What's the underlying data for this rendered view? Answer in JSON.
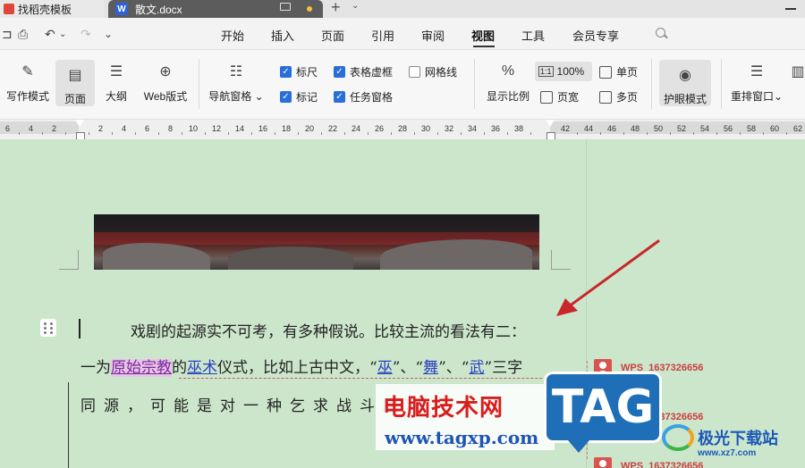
{
  "tabs": {
    "templates_label": "找稻壳模板",
    "doc_label": "散文.docx",
    "add_label": "+",
    "more_label": "⌄"
  },
  "menu": {
    "items": [
      "开始",
      "插入",
      "页面",
      "引用",
      "审阅",
      "视图",
      "工具",
      "会员专享"
    ],
    "active": "视图"
  },
  "ribbon": {
    "buttons": {
      "writing_mode": "写作模式",
      "page": "页面",
      "outline": "大纲",
      "web_layout": "Web版式",
      "nav_pane": "导航窗格",
      "zoom_ratio": "显示比例",
      "eye_protection": "护眼模式",
      "rearrange": "重排窗口"
    },
    "checkboxes": {
      "ruler": {
        "label": "标尺",
        "checked": true
      },
      "table_gridlines": {
        "label": "表格虚框",
        "checked": true
      },
      "gridlines": {
        "label": "网格线",
        "checked": false
      },
      "marks": {
        "label": "标记",
        "checked": true
      },
      "task_pane": {
        "label": "任务窗格",
        "checked": true
      }
    },
    "zoom_100": "100%",
    "zoom_100_icon_text": "1:1",
    "single_page": "单页",
    "page_width": "页宽",
    "multi_page": "多页"
  },
  "ruler": {
    "numbers": [
      "6",
      "4",
      "2",
      "2",
      "4",
      "6",
      "8",
      "10",
      "12",
      "14",
      "16",
      "18",
      "20",
      "22",
      "24",
      "26",
      "28",
      "30",
      "32",
      "34",
      "36",
      "38",
      "42",
      "44",
      "46",
      "48",
      "50",
      "52",
      "54",
      "56",
      "58",
      "60",
      "62"
    ]
  },
  "document": {
    "line1": "戏剧的起源实不可考，有多种假说。比较主流的看法有二：",
    "line2_prefix": "一为",
    "line2_hl": "原始宗教",
    "line2_mid1": "的",
    "line2_ul1": "巫术",
    "line2_mid2": "仪式，比如上古中文，“",
    "line2_ul2": "巫",
    "line2_mid3": "”、“",
    "line2_ul3": "舞",
    "line2_mid4": "”、“",
    "line2_ul4": "武",
    "line2_suffix": "”三字",
    "line3": "同源，可能是对一种乞求战斗胜利"
  },
  "comments": [
    {
      "author": "WPS_1637326656"
    },
    {
      "author": "WPS_1637326656"
    },
    {
      "author": "WPS_1637326656"
    }
  ],
  "watermark": {
    "title": "电脑技术网",
    "url": "www.tagxp.com",
    "tag": "TAG",
    "jg_text": "极光下载站",
    "jg_url": "www.xz7.com"
  },
  "colors": {
    "canvas": "#cce6cc",
    "checkbox_on": "#2a6fd8",
    "comment_red": "#d9534f",
    "arrow": "#c8262a"
  }
}
